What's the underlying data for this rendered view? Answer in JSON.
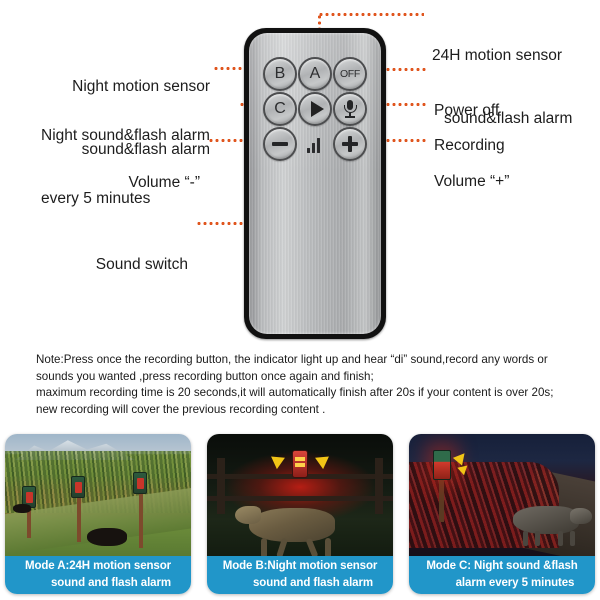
{
  "diagram": {
    "remote": {
      "buttons": [
        {
          "key": "b",
          "label": "B",
          "name": "remote-button-b"
        },
        {
          "key": "a",
          "label": "A",
          "name": "remote-button-a"
        },
        {
          "key": "off",
          "label": "OFF",
          "name": "remote-button-off"
        },
        {
          "key": "c",
          "label": "C",
          "name": "remote-button-c"
        },
        {
          "key": "play",
          "label": "",
          "name": "remote-button-play"
        },
        {
          "key": "mic",
          "label": "",
          "name": "remote-button-record"
        },
        {
          "key": "minus",
          "label": "",
          "name": "remote-button-volume-down"
        },
        {
          "key": "plus",
          "label": "",
          "name": "remote-button-volume-up"
        }
      ],
      "sound_switch_label": "sound-switch-indicator"
    },
    "callouts": {
      "night_motion_line1": "Night motion sensor",
      "night_motion_line2": "sound&flash alarm",
      "night_5min_line1": "Night sound&flash alarm",
      "night_5min_line2": "every 5 minutes",
      "volume_minus": "Volume “-”",
      "sound_switch": "Sound switch",
      "motion_24h_line1": "24H motion sensor",
      "motion_24h_line2": "sound&flash alarm",
      "power_off": "Power off",
      "recording": "Recording",
      "volume_plus": "Volume “+”"
    },
    "connector_color": "#e0561f"
  },
  "note": {
    "line1": "Note:Press once the recording button, the indicator light up and hear “di” sound,record any words or",
    "line2": "sounds you wanted ,press recording button once again and finish;",
    "line3": "maximum recording time is 20 seconds,it will automatically finish after 20s if your content  is over 20s;",
    "line4": "new recording will cover the previous recording content ."
  },
  "cards": [
    {
      "id": "mode-a",
      "caption_line1": "Mode A:24H motion sensor",
      "caption_line2": "sound and flash alarm",
      "caption_bg": "#2196c9",
      "scene": "daytime cornfield with wild boars and three mounted deterrent devices on posts"
    },
    {
      "id": "mode-b",
      "caption_line1": "Mode B:Night motion sensor",
      "caption_line2": "sound and flash alarm",
      "caption_bg": "#2196c9",
      "scene": "night field with running wolf and red flashing device on fence"
    },
    {
      "id": "mode-c",
      "caption_line1": "Mode C: Night sound &flash",
      "caption_line2": "alarm every 5 minutes",
      "caption_bg": "#2196c9",
      "scene": "night hedgerow with wild boar and red flashing device on post"
    }
  ]
}
